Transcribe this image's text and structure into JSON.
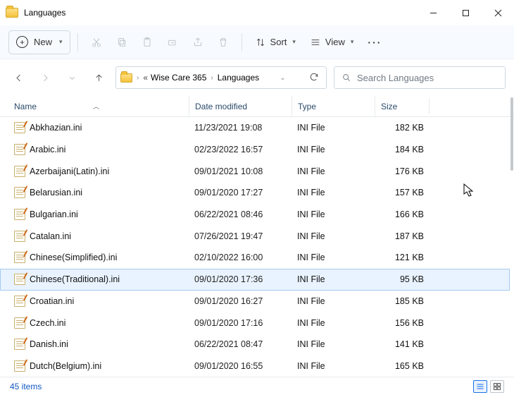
{
  "window": {
    "title": "Languages"
  },
  "toolbar": {
    "new_label": "New",
    "sort_label": "Sort",
    "view_label": "View"
  },
  "breadcrumbs": {
    "a": "Wise Care 365",
    "b": "Languages"
  },
  "search": {
    "placeholder": "Search Languages"
  },
  "columns": {
    "name": "Name",
    "date": "Date modified",
    "type": "Type",
    "size": "Size"
  },
  "files": [
    {
      "name": "Abkhazian.ini",
      "date": "11/23/2021 19:08",
      "type": "INI File",
      "size": "182 KB",
      "selected": false
    },
    {
      "name": "Arabic.ini",
      "date": "02/23/2022 16:57",
      "type": "INI File",
      "size": "184 KB",
      "selected": false
    },
    {
      "name": "Azerbaijani(Latin).ini",
      "date": "09/01/2021 10:08",
      "type": "INI File",
      "size": "176 KB",
      "selected": false
    },
    {
      "name": "Belarusian.ini",
      "date": "09/01/2020 17:27",
      "type": "INI File",
      "size": "157 KB",
      "selected": false
    },
    {
      "name": "Bulgarian.ini",
      "date": "06/22/2021 08:46",
      "type": "INI File",
      "size": "166 KB",
      "selected": false
    },
    {
      "name": "Catalan.ini",
      "date": "07/26/2021 19:47",
      "type": "INI File",
      "size": "187 KB",
      "selected": false
    },
    {
      "name": "Chinese(Simplified).ini",
      "date": "02/10/2022 16:00",
      "type": "INI File",
      "size": "121 KB",
      "selected": false
    },
    {
      "name": "Chinese(Traditional).ini",
      "date": "09/01/2020 17:36",
      "type": "INI File",
      "size": "95 KB",
      "selected": true
    },
    {
      "name": "Croatian.ini",
      "date": "09/01/2020 16:27",
      "type": "INI File",
      "size": "185 KB",
      "selected": false
    },
    {
      "name": "Czech.ini",
      "date": "09/01/2020 17:16",
      "type": "INI File",
      "size": "156 KB",
      "selected": false
    },
    {
      "name": "Danish.ini",
      "date": "06/22/2021 08:47",
      "type": "INI File",
      "size": "141 KB",
      "selected": false
    },
    {
      "name": "Dutch(Belgium).ini",
      "date": "09/01/2020 16:55",
      "type": "INI File",
      "size": "165 KB",
      "selected": false
    }
  ],
  "status": {
    "items": "45 items"
  }
}
